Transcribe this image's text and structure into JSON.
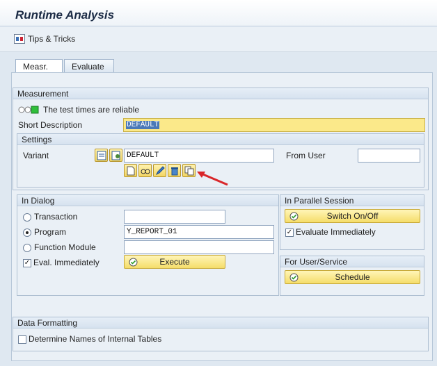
{
  "title": "Runtime Analysis",
  "toolbar": {
    "tips_label": "Tips & Tricks"
  },
  "tabs": [
    {
      "label": "Measr."
    },
    {
      "label": "Evaluate"
    }
  ],
  "measurement": {
    "header": "Measurement",
    "status_text": "The test times are reliable",
    "short_desc_label": "Short Description",
    "short_desc_value": "DEFAULT"
  },
  "settings": {
    "header": "Settings",
    "variant_label": "Variant",
    "variant_value": "DEFAULT",
    "from_user_label": "From User",
    "from_user_value": ""
  },
  "in_dialog": {
    "header": "In Dialog",
    "transaction_label": "Transaction",
    "transaction_value": "",
    "program_label": "Program",
    "program_value": "Y_REPORT_01",
    "function_module_label": "Function Module",
    "function_module_value": "",
    "eval_label": "Eval. Immediately",
    "execute_label": "Execute"
  },
  "parallel": {
    "header": "In Parallel Session",
    "switch_label": "Switch On/Off",
    "eval_label": "Evaluate Immediately"
  },
  "service": {
    "header": "For User/Service",
    "schedule_label": "Schedule"
  },
  "formatting": {
    "header": "Data Formatting",
    "determine_label": "Determine Names of Internal Tables"
  },
  "colors": {
    "accent": "#4a79b8",
    "button": "#f5dd6a",
    "annotation_arrow": "#d9262a"
  }
}
